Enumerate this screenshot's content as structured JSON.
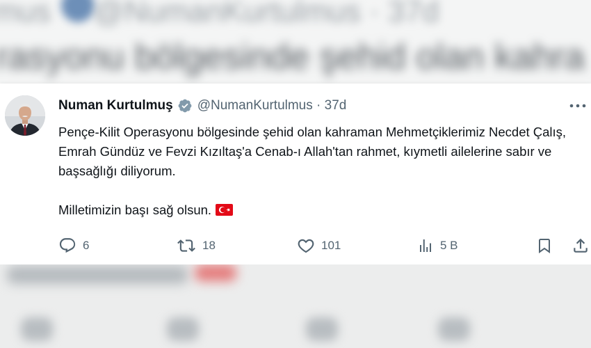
{
  "tweet": {
    "author_name": "Numan Kurtulmuş",
    "handle_line": "@NumanKurtulmus · 37d",
    "text_paragraph_1": "Pençe-Kilit Operasyonu bölgesinde şehid olan kahraman Mehmetçiklerimiz Necdet Çalış, Emrah Gündüz ve Fevzi Kızıltaş'a Cenab-ı Allah'tan rahmet, kıymetli ailelerine sabır ve başsağlığı diliyorum.",
    "text_paragraph_2": "Milletimizin başı sağ olsun.",
    "icons": {
      "verified": "verified-badge-icon",
      "more": "more-options-icon",
      "flag": "turkey-flag-icon",
      "reply": "reply-icon",
      "retweet": "retweet-icon",
      "like": "like-icon",
      "views": "views-icon",
      "bookmark": "bookmark-icon",
      "share": "share-icon"
    },
    "stats": {
      "replies": "6",
      "retweets": "18",
      "likes": "101",
      "views": "5 B"
    }
  },
  "colors": {
    "text_primary": "#0f1419",
    "text_secondary": "#536471",
    "verified_badge": "#829aab",
    "flag_red": "#e30a17"
  }
}
